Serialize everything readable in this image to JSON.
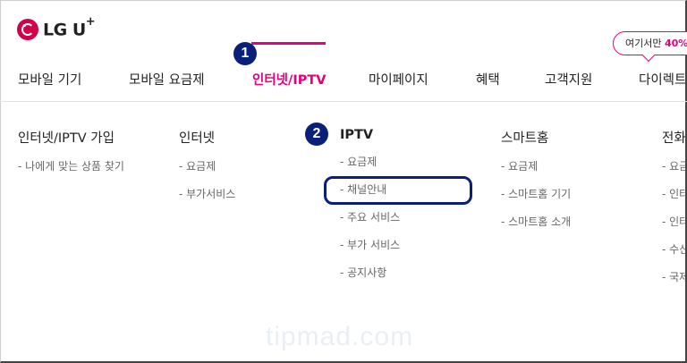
{
  "brand": {
    "logo_text": "LG U",
    "logo_plus": "+"
  },
  "promo": {
    "text": "여기서만 ",
    "highlight": "40%"
  },
  "nav": {
    "items": [
      {
        "label": "모바일 기기"
      },
      {
        "label": "모바일 요금제"
      },
      {
        "label": "인터넷/IPTV"
      },
      {
        "label": "마이페이지"
      },
      {
        "label": "혜택"
      },
      {
        "label": "고객지원"
      },
      {
        "label": "다이렉트"
      }
    ],
    "active_index": 2
  },
  "steps": {
    "one": "1",
    "two": "2"
  },
  "menu": {
    "col1": {
      "title": "인터넷/IPTV 가입",
      "items": [
        "- 나에게 맞는 상품 찾기"
      ]
    },
    "col2": {
      "title": "인터넷",
      "items": [
        "- 요금제",
        "- 부가서비스"
      ]
    },
    "col3": {
      "title": "IPTV",
      "items": [
        "- 요금제",
        "- 채널안내",
        "- 주요 서비스",
        "- 부가 서비스",
        "- 공지사항"
      ]
    },
    "col4": {
      "title": "스마트홈",
      "items": [
        "- 요금제",
        "- 스마트홈 기기",
        "- 스마트홈 소개"
      ]
    },
    "col5": {
      "title": "전화",
      "items": [
        "- 요금",
        "- 인터",
        "- 인터",
        "- 수신",
        "- 국제"
      ]
    }
  },
  "watermark": "tipmad.com",
  "colors": {
    "accent": "#e6007e",
    "brand": "#d1004b",
    "annotation": "#0a1f7a"
  }
}
